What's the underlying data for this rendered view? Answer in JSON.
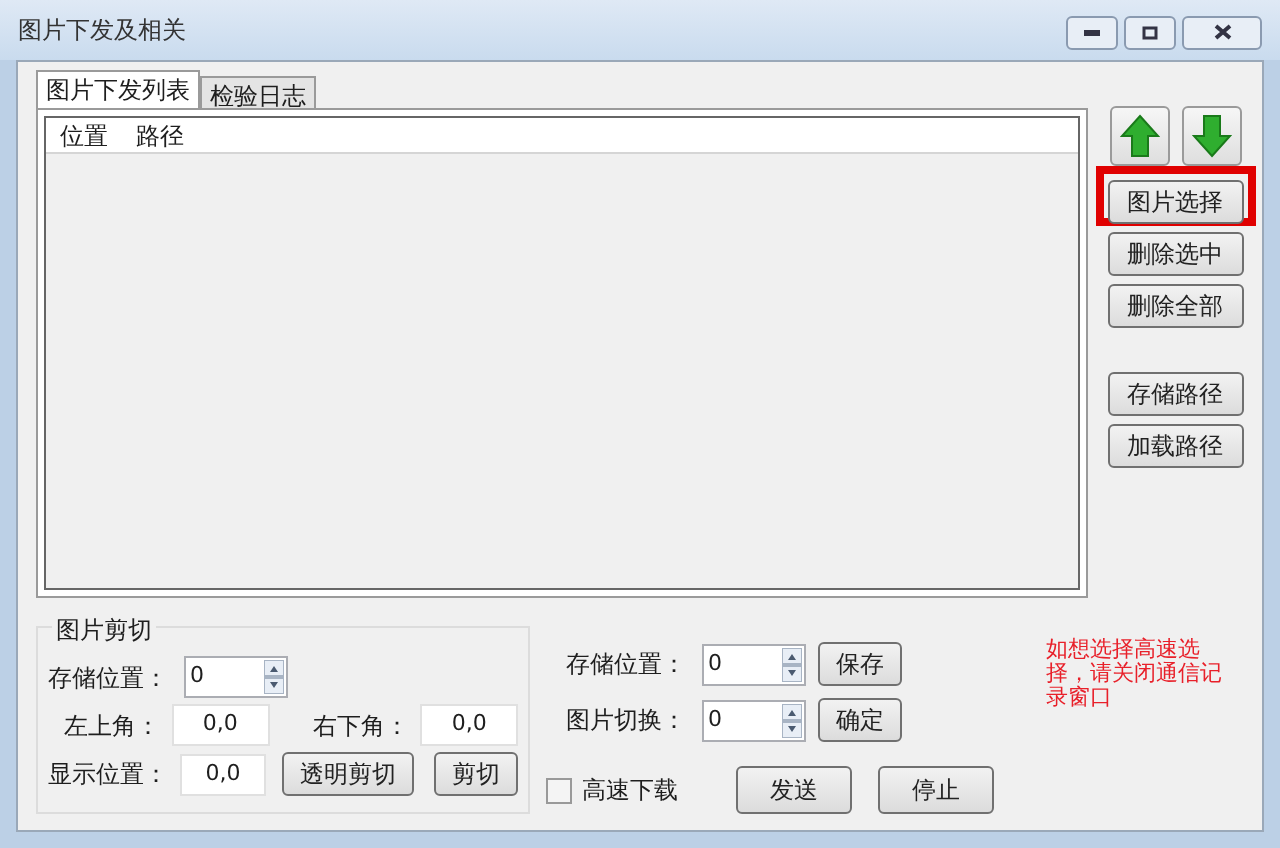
{
  "window": {
    "title": "图片下发及相关"
  },
  "tabs": [
    {
      "label": "图片下发列表",
      "selected": true
    },
    {
      "label": "检验日志",
      "selected": false
    }
  ],
  "list": {
    "columns": [
      "位置",
      "路径"
    ]
  },
  "side_buttons": [
    {
      "label": "图片选择",
      "highlighted": true
    },
    {
      "label": "删除选中",
      "highlighted": false
    },
    {
      "label": "删除全部",
      "highlighted": false
    },
    {
      "label": "存储路径",
      "highlighted": false
    },
    {
      "label": "加载路径",
      "highlighted": false
    }
  ],
  "crop_group": {
    "title": "图片剪切",
    "store_label": "存储位置：",
    "store_value": "0",
    "top_left_label": "左上角：",
    "top_left_value": "0,0",
    "bottom_right_label": "右下角：",
    "bottom_right_value": "0,0",
    "display_label": "显示位置：",
    "display_value": "0,0",
    "buttons": [
      "透明剪切",
      "剪切"
    ]
  },
  "store": {
    "label": "存储位置：",
    "value": "0",
    "button": "保存"
  },
  "switch": {
    "label": "图片切换：",
    "value": "0",
    "button": "确定"
  },
  "high_speed": {
    "label": "高速下载",
    "checked": false
  },
  "actions": [
    "发送",
    "停止"
  ],
  "notice": "如想选择高速选择，请关闭通信记录窗口"
}
